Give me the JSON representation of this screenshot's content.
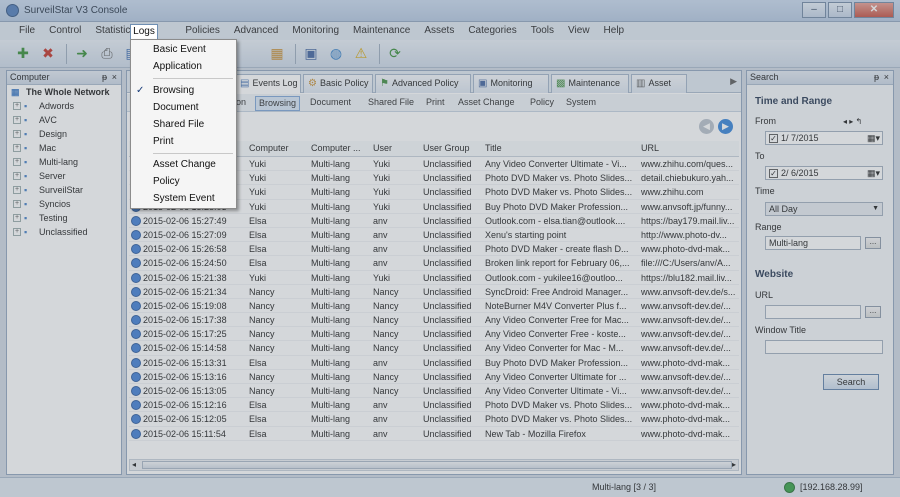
{
  "window": {
    "title": "SurveilStar V3 Console",
    "buttons": [
      "–",
      "□",
      "✕"
    ]
  },
  "menubar": [
    "File",
    "Control",
    "Statistics",
    "Logs",
    "Policies",
    "Advanced",
    "Monitoring",
    "Maintenance",
    "Assets",
    "Categories",
    "Tools",
    "View",
    "Help"
  ],
  "logs_menu": {
    "items": [
      "Basic Event",
      "Application",
      "Browsing",
      "Document",
      "Shared File",
      "Print",
      "Asset Change",
      "Policy",
      "System Event"
    ],
    "checked": "Browsing"
  },
  "left_panel": {
    "title": "Computer",
    "root": "The Whole Network",
    "groups": [
      "Adwords",
      "AVC",
      "Design",
      "Mac",
      "Multi-lang",
      "Server",
      "SurveilStar",
      "Syncios",
      "Testing",
      "Unclassified"
    ]
  },
  "main_tabs": [
    "Events Log",
    "Basic Policy",
    "Advanced Policy",
    "Monitoring",
    "Maintenance",
    "Asset"
  ],
  "sub_tabs": [
    "on",
    "Browsing",
    "Document",
    "Shared File",
    "Print",
    "Asset Change",
    "Policy",
    "System"
  ],
  "grid": {
    "columns": [
      "Computer",
      "Computer ...",
      "User",
      "User Group",
      "Title",
      "URL"
    ],
    "rows": [
      {
        "time": "",
        "computer": "Yuki",
        "computer2": "Multi-lang",
        "user": "Yuki",
        "group": "Unclassified",
        "title": "Any Video Converter Ultimate - Vi...",
        "url": "www.zhihu.com/ques..."
      },
      {
        "time": "",
        "computer": "Yuki",
        "computer2": "Multi-lang",
        "user": "Yuki",
        "group": "Unclassified",
        "title": "Photo DVD Maker vs. Photo Slides...",
        "url": "detail.chiebukuro.yah..."
      },
      {
        "time": "",
        "computer": "Yuki",
        "computer2": "Multi-lang",
        "user": "Yuki",
        "group": "Unclassified",
        "title": "Photo DVD Maker vs. Photo Slides...",
        "url": "www.zhihu.com"
      },
      {
        "time": "2015-02-06 15:28:03",
        "computer": "Yuki",
        "computer2": "Multi-lang",
        "user": "Yuki",
        "group": "Unclassified",
        "title": "Buy Photo DVD Maker Profession...",
        "url": "www.anvsoft.jp/funny..."
      },
      {
        "time": "2015-02-06 15:27:49",
        "computer": "Elsa",
        "computer2": "Multi-lang",
        "user": "anv",
        "group": "Unclassified",
        "title": "Outlook.com - elsa.tian@outlook....",
        "url": "https://bay179.mail.liv..."
      },
      {
        "time": "2015-02-06 15:27:09",
        "computer": "Elsa",
        "computer2": "Multi-lang",
        "user": "anv",
        "group": "Unclassified",
        "title": "Xenu's starting point",
        "url": "http://www.photo-dv..."
      },
      {
        "time": "2015-02-06 15:26:58",
        "computer": "Elsa",
        "computer2": "Multi-lang",
        "user": "anv",
        "group": "Unclassified",
        "title": "Photo DVD Maker - create flash D...",
        "url": "www.photo-dvd-mak..."
      },
      {
        "time": "2015-02-06 15:24:50",
        "computer": "Elsa",
        "computer2": "Multi-lang",
        "user": "anv",
        "group": "Unclassified",
        "title": "Broken link report for February 06,...",
        "url": "file:///C:/Users/anv/A..."
      },
      {
        "time": "2015-02-06 15:21:38",
        "computer": "Yuki",
        "computer2": "Multi-lang",
        "user": "Yuki",
        "group": "Unclassified",
        "title": "Outlook.com - yukilee16@outloo...",
        "url": "https://blu182.mail.liv..."
      },
      {
        "time": "2015-02-06 15:21:34",
        "computer": "Nancy",
        "computer2": "Multi-lang",
        "user": "Nancy",
        "group": "Unclassified",
        "title": "SyncDroid: Free Android Manager...",
        "url": "www.anvsoft-dev.de/s..."
      },
      {
        "time": "2015-02-06 15:19:08",
        "computer": "Nancy",
        "computer2": "Multi-lang",
        "user": "Nancy",
        "group": "Unclassified",
        "title": "NoteBurner M4V Converter Plus f...",
        "url": "www.anvsoft-dev.de/..."
      },
      {
        "time": "2015-02-06 15:17:38",
        "computer": "Nancy",
        "computer2": "Multi-lang",
        "user": "Nancy",
        "group": "Unclassified",
        "title": "Any Video Converter Free for Mac...",
        "url": "www.anvsoft-dev.de/..."
      },
      {
        "time": "2015-02-06 15:17:25",
        "computer": "Nancy",
        "computer2": "Multi-lang",
        "user": "Nancy",
        "group": "Unclassified",
        "title": "Any Video Converter Free - koste...",
        "url": "www.anvsoft-dev.de/..."
      },
      {
        "time": "2015-02-06 15:14:58",
        "computer": "Nancy",
        "computer2": "Multi-lang",
        "user": "Nancy",
        "group": "Unclassified",
        "title": "Any Video Converter for Mac - M...",
        "url": "www.anvsoft-dev.de/..."
      },
      {
        "time": "2015-02-06 15:13:31",
        "computer": "Elsa",
        "computer2": "Multi-lang",
        "user": "anv",
        "group": "Unclassified",
        "title": "Buy Photo DVD Maker Profession...",
        "url": "www.photo-dvd-mak..."
      },
      {
        "time": "2015-02-06 15:13:16",
        "computer": "Nancy",
        "computer2": "Multi-lang",
        "user": "Nancy",
        "group": "Unclassified",
        "title": "Any Video Converter Ultimate for ...",
        "url": "www.anvsoft-dev.de/..."
      },
      {
        "time": "2015-02-06 15:13:05",
        "computer": "Nancy",
        "computer2": "Multi-lang",
        "user": "Nancy",
        "group": "Unclassified",
        "title": "Any Video Converter Ultimate - Vi...",
        "url": "www.anvsoft-dev.de/..."
      },
      {
        "time": "2015-02-06 15:12:16",
        "computer": "Elsa",
        "computer2": "Multi-lang",
        "user": "anv",
        "group": "Unclassified",
        "title": "Photo DVD Maker vs. Photo Slides...",
        "url": "www.photo-dvd-mak..."
      },
      {
        "time": "2015-02-06 15:12:05",
        "computer": "Elsa",
        "computer2": "Multi-lang",
        "user": "anv",
        "group": "Unclassified",
        "title": "Photo DVD Maker vs. Photo Slides...",
        "url": "www.photo-dvd-mak..."
      },
      {
        "time": "2015-02-06 15:11:54",
        "computer": "Elsa",
        "computer2": "Multi-lang",
        "user": "anv",
        "group": "Unclassified",
        "title": "New Tab - Mozilla Firefox",
        "url": "www.photo-dvd-mak..."
      }
    ]
  },
  "search_panel": {
    "title": "Search",
    "time_range_title": "Time and Range",
    "from_label": "From",
    "from_value": "1/ 7/2015",
    "to_label": "To",
    "to_value": "2/ 6/2015",
    "time_label": "Time",
    "time_value": "All Day",
    "range_label": "Range",
    "range_value": "Multi-lang",
    "website_title": "Website",
    "url_label": "URL",
    "url_value": "",
    "window_title_label": "Window Title",
    "window_title_value": "",
    "search_button": "Search",
    "ellipsis": "..."
  },
  "statusbar": {
    "page_info": "Multi-lang [3 / 3]",
    "server": "[192.168.28.99]"
  }
}
